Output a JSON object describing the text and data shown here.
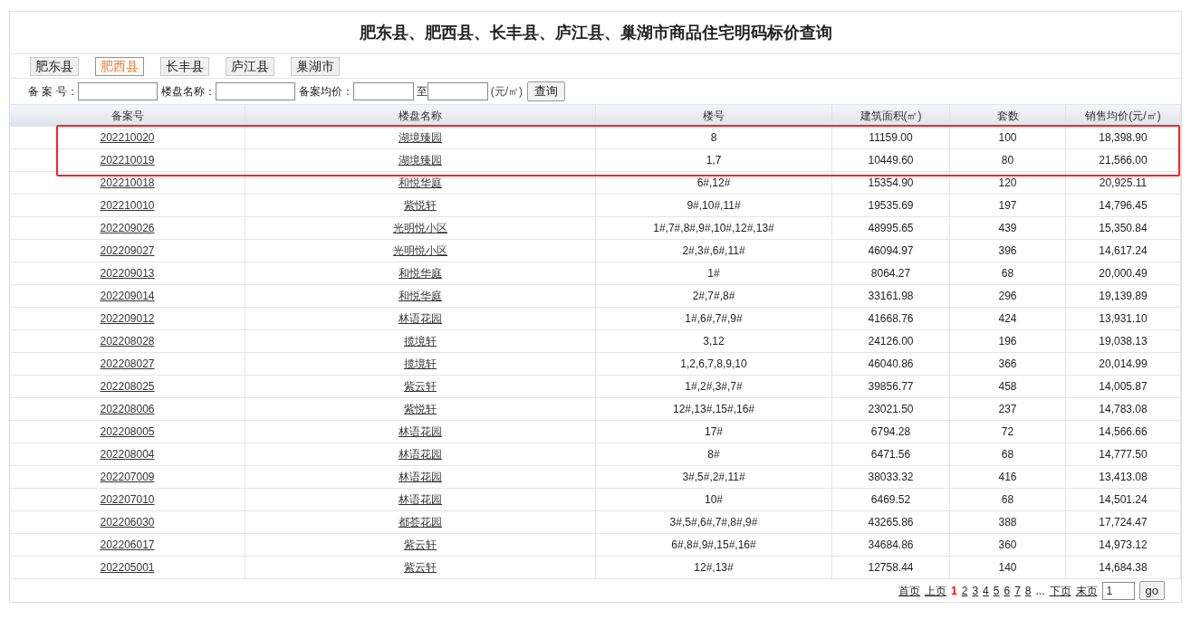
{
  "title": "肥东县、肥西县、长丰县、庐江县、巢湖市商品住宅明码标价查询",
  "tabs": [
    {
      "label": "肥东县",
      "selected": false
    },
    {
      "label": "肥西县",
      "selected": true
    },
    {
      "label": "长丰县",
      "selected": false
    },
    {
      "label": "庐江县",
      "selected": false
    },
    {
      "label": "巢湖市",
      "selected": false
    }
  ],
  "search": {
    "record_label": "备 案 号：",
    "name_label": "楼盘名称：",
    "price_label": "备案均价：",
    "to_label": "至",
    "unit": "(元/㎡)",
    "button": "查询"
  },
  "table": {
    "columns": [
      "备案号",
      "楼盘名称",
      "楼号",
      "建筑面积(㎡)",
      "套数",
      "销售均价(元/㎡)"
    ],
    "rows": [
      [
        "202210020",
        "湖境臻园",
        "8",
        "11159.00",
        "100",
        "18,398.90"
      ],
      [
        "202210019",
        "湖境臻园",
        "1,7",
        "10449.60",
        "80",
        "21,566.00"
      ],
      [
        "202210018",
        "和悦华庭",
        "6#,12#",
        "15354.90",
        "120",
        "20,925.11"
      ],
      [
        "202210010",
        "紫悦轩",
        "9#,10#,11#",
        "19535.69",
        "197",
        "14,796.45"
      ],
      [
        "202209026",
        "光明悦小区",
        "1#,7#,8#,9#,10#,12#,13#",
        "48995.65",
        "439",
        "15,350.84"
      ],
      [
        "202209027",
        "光明悦小区",
        "2#,3#,6#,11#",
        "46094.97",
        "396",
        "14,617.24"
      ],
      [
        "202209013",
        "和悦华庭",
        "1#",
        "8064.27",
        "68",
        "20,000.49"
      ],
      [
        "202209014",
        "和悦华庭",
        "2#,7#,8#",
        "33161.98",
        "296",
        "19,139.89"
      ],
      [
        "202209012",
        "林语花园",
        "1#,6#,7#,9#",
        "41668.76",
        "424",
        "13,931.10"
      ],
      [
        "202208028",
        "揽境轩",
        "3,12",
        "24126.00",
        "196",
        "19,038.13"
      ],
      [
        "202208027",
        "揽境轩",
        "1,2,6,7,8,9,10",
        "46040.86",
        "366",
        "20,014.99"
      ],
      [
        "202208025",
        "紫云轩",
        "1#,2#,3#,7#",
        "39856.77",
        "458",
        "14,005.87"
      ],
      [
        "202208006",
        "紫悦轩",
        "12#,13#,15#,16#",
        "23021.50",
        "237",
        "14,783.08"
      ],
      [
        "202208005",
        "林语花园",
        "17#",
        "6794.28",
        "72",
        "14,566.66"
      ],
      [
        "202208004",
        "林语花园",
        "8#",
        "6471.56",
        "68",
        "14,777.50"
      ],
      [
        "202207009",
        "林语花园",
        "3#,5#,2#,11#",
        "38033.32",
        "416",
        "13,413.08"
      ],
      [
        "202207010",
        "林语花园",
        "10#",
        "6469.52",
        "68",
        "14,501.24"
      ],
      [
        "202206030",
        "都荟花园",
        "3#,5#,6#,7#,8#,9#",
        "43265.86",
        "388",
        "17,724.47"
      ],
      [
        "202206017",
        "紫云轩",
        "6#,8#,9#,15#,16#",
        "34684.86",
        "360",
        "14,973.12"
      ],
      [
        "202205001",
        "紫云轩",
        "12#,13#",
        "12758.44",
        "140",
        "14,684.38"
      ]
    ]
  },
  "pagination": {
    "first": "首页",
    "prev": "上页",
    "pages": [
      {
        "label": "1",
        "selected": true
      },
      {
        "label": "2",
        "selected": false
      },
      {
        "label": "3",
        "selected": false
      },
      {
        "label": "4",
        "selected": false
      },
      {
        "label": "5",
        "selected": false
      },
      {
        "label": "6",
        "selected": false
      },
      {
        "label": "7",
        "selected": false
      },
      {
        "label": "8",
        "selected": false
      }
    ],
    "ellipsis": "...",
    "next": "下页",
    "last": "末页",
    "page_input": "1",
    "go": "go"
  }
}
